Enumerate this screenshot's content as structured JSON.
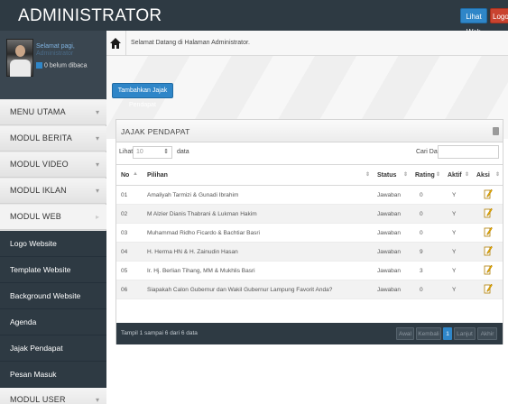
{
  "header": {
    "brand": "ADMINISTRATOR",
    "lihat_web": "Lihat Web",
    "logout": "Logout"
  },
  "profile": {
    "welcome": "Selamat pagi,",
    "name": "Administrator",
    "unread": "0 belum dibaca"
  },
  "sidebar": {
    "menus": [
      {
        "label": "MENU UTAMA"
      },
      {
        "label": "MODUL BERITA"
      },
      {
        "label": "MODUL VIDEO"
      },
      {
        "label": "MODUL IKLAN"
      },
      {
        "label": "MODUL WEB"
      }
    ],
    "submenu": [
      {
        "label": "Logo Website"
      },
      {
        "label": "Template Website"
      },
      {
        "label": "Background Website"
      },
      {
        "label": "Agenda"
      },
      {
        "label": "Jajak Pendapat"
      },
      {
        "label": "Pesan Masuk"
      }
    ],
    "last_menu": "MODUL USER"
  },
  "breadcrumb": {
    "text": "Selamat Datang di Halaman Administrator."
  },
  "actions": {
    "add_button": "Tambahkan Jajak Pendapat"
  },
  "panel": {
    "title": "JAJAK PENDAPAT",
    "show_label": "Lihat",
    "page_size": "10",
    "data_label": "data",
    "search_label": "Cari Data:",
    "search_value": ""
  },
  "table": {
    "headers": [
      "No",
      "Pilihan",
      "Status",
      "Rating",
      "Aktif",
      "Aksi"
    ],
    "rows": [
      {
        "no": "01",
        "pilihan": "Amaliyah Tarmizi & Gunadi Ibrahim",
        "status": "Jawaban",
        "rating": "0",
        "aktif": "Y"
      },
      {
        "no": "02",
        "pilihan": "M Alzier Dianis Thabrani & Lukman Hakim",
        "status": "Jawaban",
        "rating": "0",
        "aktif": "Y"
      },
      {
        "no": "03",
        "pilihan": "Muhammad Ridho Ficardo & Bachtiar Basri",
        "status": "Jawaban",
        "rating": "0",
        "aktif": "Y"
      },
      {
        "no": "04",
        "pilihan": "H. Herma HN & H. Zainudin Hasan",
        "status": "Jawaban",
        "rating": "9",
        "aktif": "Y"
      },
      {
        "no": "05",
        "pilihan": "Ir. Hj. Berlian Tihang, MM & Mukhlis Basri",
        "status": "Jawaban",
        "rating": "3",
        "aktif": "Y"
      },
      {
        "no": "06",
        "pilihan": "Siapakah Calon Gubernur dan Wakil Gubernur Lampung Favorit Anda?",
        "status": "Jawaban",
        "rating": "0",
        "aktif": "Y"
      }
    ]
  },
  "footer": {
    "info": "Tampil 1 sampai 6 dari 6 data",
    "pagination": {
      "first": "Awal",
      "prev": "Kembali",
      "current": "1",
      "next": "Lanjut",
      "last": "Akhir"
    }
  },
  "colors": {
    "topbar": "#2e3a43",
    "primary": "#2f86c8",
    "danger": "#c9432f",
    "edit_icon": "#e8a800"
  }
}
